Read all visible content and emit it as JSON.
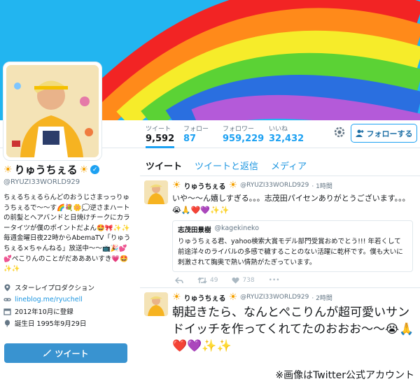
{
  "profile": {
    "display_name": "りゅうちぇる",
    "handle": "@RYUZI33WORLD929",
    "bio": "ちぇるちぇるらんどのおうじさまっっりゅうちぇるで〜〜す🌈💐🌼💭逆さまハートの前髪とヘアバンドと日焼けチークにカラータイツが僕のポイントだよん🤩🎀✨✨ 毎週金曜日夜22時からAbemaTV「りゅうちぇる×ちゃんねる」放送中〜〜📺🎉💕💕ぺこりんのことがだあああいすき💗🤩✨✨",
    "location": "スターレイプロダクション",
    "website": "lineblog.me/ryuchell",
    "joined": "2012年10月に登録",
    "birthday": "誕生日 1995年9月29日",
    "tweet_button": "ツイート"
  },
  "stats": {
    "tweets_label": "ツイート",
    "tweets_value": "9,592",
    "following_label": "フォロー",
    "following_value": "87",
    "followers_label": "フォロワー",
    "followers_value": "959,229",
    "likes_label": "いいね",
    "likes_value": "32,432"
  },
  "follow_button": "フォローする",
  "tabs": [
    "ツイート",
    "ツイートと返信",
    "メディア"
  ],
  "tweets": [
    {
      "name": "りゅうちぇる",
      "handle": "@RYUZI33WORLD929",
      "time": "· 1時間",
      "text": "いや〜〜ん嬉しすぎる。。。志茂田パイセンありがとうございます。。。😭🙏❤️💜✨✨",
      "quote": {
        "name": "志茂田景樹",
        "handle": "@kagekineko",
        "text": "りゅうちぇる君、yahoo検索大賞モデル部門受賞おめでとう!!! 年若くして前途洋々のライバルの多感で穢することのない活躍に乾杯です。僕も大いに刺激されて胸奥で熱い情熱がたぎっています。"
      },
      "retweets": "49",
      "likes": "738"
    },
    {
      "name": "りゅうちぇる",
      "handle": "@RYUZI33WORLD929",
      "time": "· 2時間",
      "text": "朝起きたら、なんとぺこりんが超可愛いサンドイッチを作ってくれてたのおおお〜〜😭🙏❤️💜✨✨"
    }
  ],
  "caption": "※画像はTwitter公式アカウント",
  "colors": {
    "accent": "#1da1f2",
    "banner": "#22b5f0",
    "button": "#3993d0"
  }
}
